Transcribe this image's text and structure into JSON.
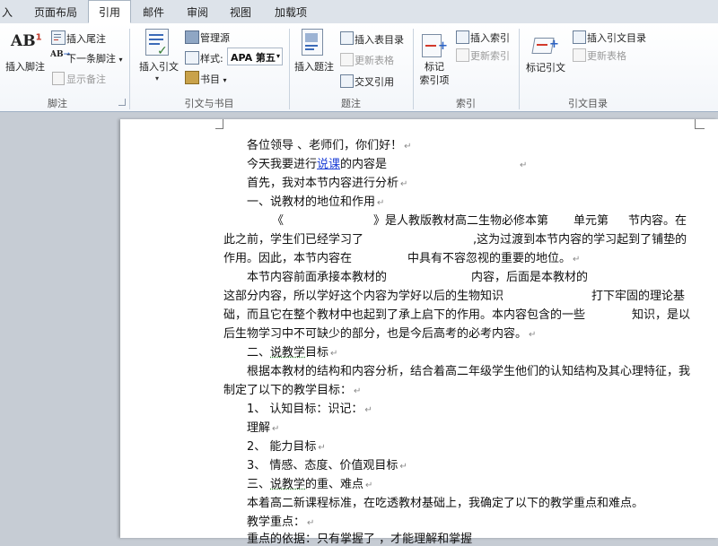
{
  "tabs": [
    "入",
    "页面布局",
    "引用",
    "邮件",
    "审阅",
    "视图",
    "加载项"
  ],
  "ribbon": {
    "groups": {
      "footnote": "脚注",
      "citations": "引文与书目",
      "captions": "题注",
      "index": "索引",
      "toa": "引文目录"
    },
    "insert_footnote": "插入脚注",
    "insert_endnote": "插入尾注",
    "next_footnote": "下一条脚注",
    "show_notes": "显示备注",
    "insert_citation": "插入引文",
    "manage_sources": "管理源",
    "style_label": "样式:",
    "style_value": "APA 第五",
    "bibliography": "书目",
    "insert_caption": "插入题注",
    "insert_table_of_figures": "插入表目录",
    "update_table": "更新表格",
    "cross_reference": "交叉引用",
    "mark_entry_line1": "标记",
    "mark_entry_line2": "索引项",
    "insert_index": "插入索引",
    "update_index": "更新索引",
    "mark_citation": "标记引文",
    "insert_toa": "插入引文目录",
    "update_toa": "更新表格",
    "ab_icon_text": "AB",
    "ab_super": "1",
    "ab_small": "AB"
  },
  "document": {
    "para_mark": "↵",
    "lines": {
      "l1": "各位领导  、老师们，你们好！",
      "l2a": "今天我要进行",
      "l2b": "说课",
      "l2c": "的内容是",
      "l3": "首先，我对本节内容进行分析",
      "l4": "一、说教材的地位和作用",
      "l5a": "《",
      "l5b": "》是人教版教材高二生物必修本第",
      "l5c": "单元第",
      "l5d": "节内容。在",
      "l6a": "此之前，学生们已经学习了",
      "l6b": ",这为过渡到本节内容的学习起到了铺垫的",
      "l7a": "作用。因此，本节内容在",
      "l7b": "中具有不容忽视的重要的地位。",
      "l8a": "本节内容前面承接本教材的",
      "l8b": "内容，后面是本教材的",
      "l9a": "这部分内容，所以学好这个内容为学好以后的生物知识",
      "l9b": "打下牢固的理论基",
      "l10a": "础，而且它在整个教材中也起到了承上启下的作用。本内容包含的一些",
      "l10b": "知识，是以",
      "l11": "后生物学习中不可缺少的部分，也是今后高考的必考内容。",
      "l12a": "二、",
      "l12b": "说教学",
      "l12c": "目标",
      "l13": "根据本教材的结构和内容分析，结合着高二年级学生他们的认知结构及其心理特征，我",
      "l14": "制定了以下的教学目标：",
      "l15": "1、   认知目标：识记：",
      "l16": "理解",
      "l17": "2、   能力目标",
      "l18": "3、   情感、态度、价值观目标",
      "l19a": "三、",
      "l19b": "说教学",
      "l19c": "的重、难点",
      "l20": "本着高二新课程标准，在吃透教材基础上，我确定了以下的教学重点和难点。",
      "l21": "教学重点：",
      "l22": "重点的依据：只有掌握了              ，才能理解和掌握"
    }
  }
}
